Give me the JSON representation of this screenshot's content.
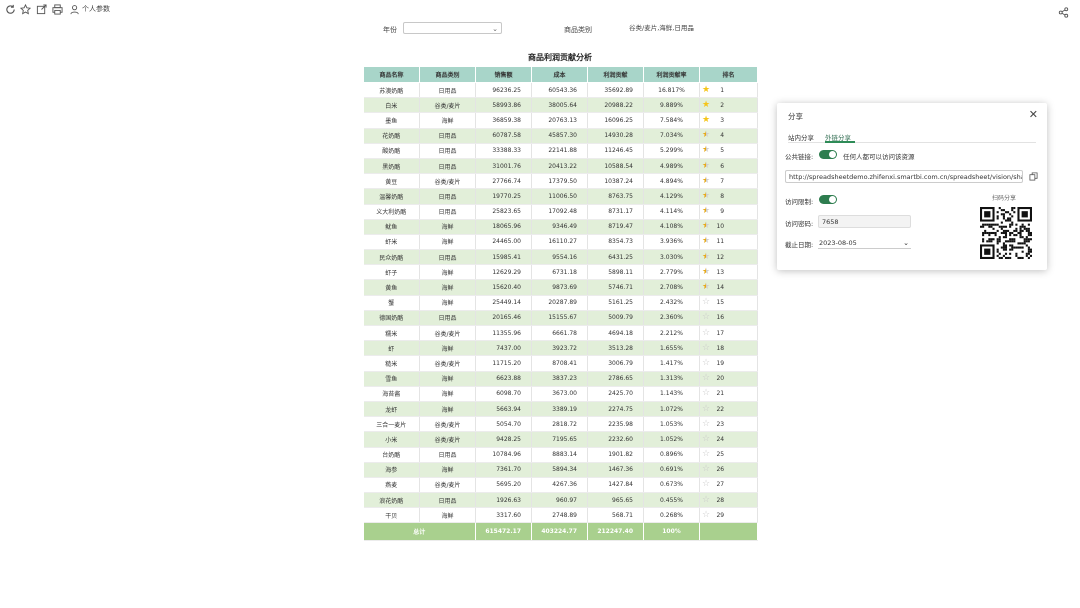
{
  "toolbar": {
    "personal_params_label": "个人参数"
  },
  "filters": {
    "year_label": "年份",
    "year_value": "",
    "category_label": "商品类别",
    "category_value": "谷类/麦片,海鲜,日用品"
  },
  "report": {
    "title": "商品利润贡献分析",
    "columns": [
      "商品名称",
      "商品类别",
      "销售额",
      "成本",
      "利润贡献",
      "利润贡献率",
      "排名"
    ],
    "rows": [
      [
        "苏澳奶酪",
        "日用品",
        "96236.25",
        "60543.36",
        "35692.89",
        "16.817%",
        "gold",
        "1"
      ],
      [
        "白米",
        "谷类/麦片",
        "58993.86",
        "38005.64",
        "20988.22",
        "9.889%",
        "gold",
        "2"
      ],
      [
        "墨鱼",
        "海鲜",
        "36859.38",
        "20763.13",
        "16096.25",
        "7.584%",
        "gold",
        "3"
      ],
      [
        "花奶酪",
        "日用品",
        "60787.58",
        "45857.30",
        "14930.28",
        "7.034%",
        "half",
        "4"
      ],
      [
        "酸奶酪",
        "日用品",
        "33388.33",
        "22141.88",
        "11246.45",
        "5.299%",
        "half",
        "5"
      ],
      [
        "黑奶酪",
        "日用品",
        "31001.76",
        "20413.22",
        "10588.54",
        "4.989%",
        "half",
        "6"
      ],
      [
        "黄豆",
        "谷类/麦片",
        "27766.74",
        "17379.50",
        "10387.24",
        "4.894%",
        "half",
        "7"
      ],
      [
        "温馨奶酪",
        "日用品",
        "19770.25",
        "11006.50",
        "8763.75",
        "4.129%",
        "half",
        "8"
      ],
      [
        "义大利奶酪",
        "日用品",
        "25823.65",
        "17092.48",
        "8731.17",
        "4.114%",
        "half",
        "9"
      ],
      [
        "鱿鱼",
        "海鲜",
        "18065.96",
        "9346.49",
        "8719.47",
        "4.108%",
        "half",
        "10"
      ],
      [
        "虾米",
        "海鲜",
        "24465.00",
        "16110.27",
        "8354.73",
        "3.936%",
        "half",
        "11"
      ],
      [
        "民众奶酪",
        "日用品",
        "15985.41",
        "9554.16",
        "6431.25",
        "3.030%",
        "half",
        "12"
      ],
      [
        "虾子",
        "海鲜",
        "12629.29",
        "6731.18",
        "5898.11",
        "2.779%",
        "half",
        "13"
      ],
      [
        "黄鱼",
        "海鲜",
        "15620.40",
        "9873.69",
        "5746.71",
        "2.708%",
        "half",
        "14"
      ],
      [
        "蟹",
        "海鲜",
        "25449.14",
        "20287.89",
        "5161.25",
        "2.432%",
        "empty",
        "15"
      ],
      [
        "德国奶酪",
        "日用品",
        "20165.46",
        "15155.67",
        "5009.79",
        "2.360%",
        "empty",
        "16"
      ],
      [
        "糯米",
        "谷类/麦片",
        "11355.96",
        "6661.78",
        "4694.18",
        "2.212%",
        "empty",
        "17"
      ],
      [
        "虾",
        "海鲜",
        "7437.00",
        "3923.72",
        "3513.28",
        "1.655%",
        "empty",
        "18"
      ],
      [
        "糙米",
        "谷类/麦片",
        "11715.20",
        "8708.41",
        "3006.79",
        "1.417%",
        "empty",
        "19"
      ],
      [
        "雪鱼",
        "海鲜",
        "6623.88",
        "3837.23",
        "2786.65",
        "1.313%",
        "empty",
        "20"
      ],
      [
        "海苔酱",
        "海鲜",
        "6098.70",
        "3673.00",
        "2425.70",
        "1.143%",
        "empty",
        "21"
      ],
      [
        "龙虾",
        "海鲜",
        "5663.94",
        "3389.19",
        "2274.75",
        "1.072%",
        "empty",
        "22"
      ],
      [
        "三合一麦片",
        "谷类/麦片",
        "5054.70",
        "2818.72",
        "2235.98",
        "1.053%",
        "empty",
        "23"
      ],
      [
        "小米",
        "谷类/麦片",
        "9428.25",
        "7195.65",
        "2232.60",
        "1.052%",
        "empty",
        "24"
      ],
      [
        "台奶酪",
        "日用品",
        "10784.96",
        "8883.14",
        "1901.82",
        "0.896%",
        "empty",
        "25"
      ],
      [
        "海参",
        "海鲜",
        "7361.70",
        "5894.34",
        "1467.36",
        "0.691%",
        "empty",
        "26"
      ],
      [
        "燕麦",
        "谷类/麦片",
        "5695.20",
        "4267.36",
        "1427.84",
        "0.673%",
        "empty",
        "27"
      ],
      [
        "浪花奶酪",
        "日用品",
        "1926.63",
        "960.97",
        "965.65",
        "0.455%",
        "empty",
        "28"
      ],
      [
        "干贝",
        "海鲜",
        "3317.60",
        "2748.89",
        "568.71",
        "0.268%",
        "empty",
        "29"
      ]
    ],
    "total": {
      "label": "总计",
      "sales": "615472.17",
      "cost": "403224.77",
      "profit": "212247.40",
      "rate": "100%"
    }
  },
  "share_dialog": {
    "title": "分享",
    "tab_internal": "站内分享",
    "tab_external": "外链分享",
    "public_link_label": "公共链接:",
    "public_link_desc": "任何人都可以访问该资源",
    "url": "http://spreadsheetdemo.zhifenxi.smartbi.com.cn/spreadsheet/vision/share",
    "access_limit_label": "访问限制:",
    "access_code_label": "访问密码:",
    "access_code": "7658",
    "expiry_label": "截止日期:",
    "expiry_date": "2023-08-05",
    "qr_label": "扫码分享"
  },
  "colors": {
    "header_bg": "#a8d5c9",
    "alt_row_bg": "#e2efd9",
    "total_bg": "#a9d08e",
    "toggle_on": "#2e7d4f",
    "star_gold": "#f5c518"
  }
}
